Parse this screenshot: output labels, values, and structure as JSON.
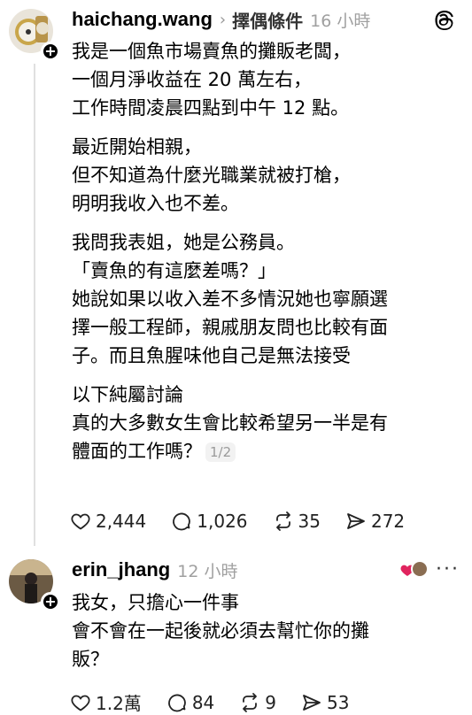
{
  "post1": {
    "username": "haichang.wang",
    "topic": "擇偶條件",
    "time": "16 小時",
    "paragraphs": [
      [
        "我是一個魚市場賣魚的攤販老闆，",
        "一個月淨收益在 20 萬左右，",
        "工作時間凌晨四點到中午 12 點。"
      ],
      [
        "最近開始相親，",
        "但不知道為什麼光職業就被打槍，",
        "明明我收入也不差。"
      ],
      [
        "我問我表姐，她是公務員。",
        "「賣魚的有這麼差嗎？」",
        "她說如果以收入差不多情況她也寧願選",
        "擇一般工程師，親戚朋友問也比較有面",
        "子。而且魚腥味他自己是無法接受"
      ],
      [
        "以下純屬討論",
        "真的大多數女生會比較希望另一半是有",
        "體面的工作嗎？"
      ]
    ],
    "page_indicator": "1/2",
    "likes": "2,444",
    "comments": "1,026",
    "reposts": "35",
    "shares": "272"
  },
  "post2": {
    "username": "erin_jhang",
    "time": "12 小時",
    "lines": [
      "我女，只擔心一件事",
      "會不會在一起後就必須去幫忙你的攤",
      "販？"
    ],
    "likes": "1.2萬",
    "comments": "84",
    "reposts": "9",
    "shares": "53"
  },
  "icons": {
    "follow": "plus-icon",
    "logo": "threads-logo-icon",
    "like": "heart-icon",
    "comment": "comment-bubble-icon",
    "repost": "repost-icon",
    "share": "send-icon",
    "more": "more-dots-icon"
  },
  "colors": {
    "secondary_text": "#a0a0a0",
    "liked_heart": "#e0245e"
  }
}
